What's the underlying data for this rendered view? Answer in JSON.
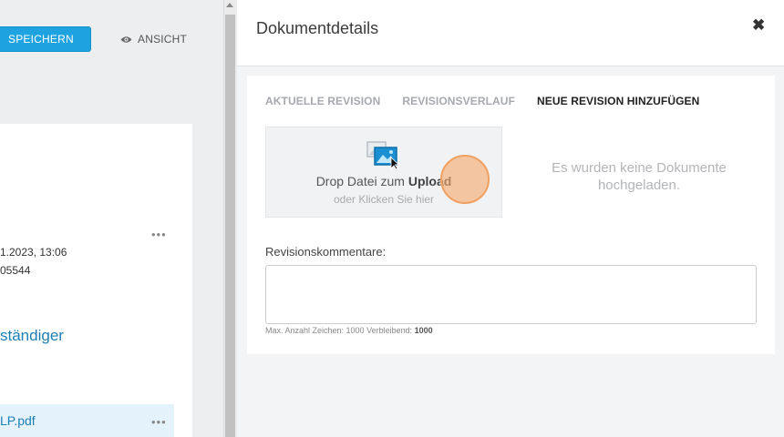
{
  "toolbar": {
    "save_label": "SPEICHERN",
    "view_label": "ANSICHT"
  },
  "background_card": {
    "meta_date": "1.2023, 13:06",
    "meta_id": "05544",
    "section_title": "ständiger",
    "file_name": "LP.pdf",
    "more_dots": "•••"
  },
  "panel": {
    "title": "Dokumentdetails",
    "close_glyph": "✖",
    "tabs": [
      {
        "label": "AKTUELLE REVISION",
        "active": false
      },
      {
        "label": "REVISIONSVERLAUF",
        "active": false
      },
      {
        "label": "NEUE REVISION HINZUFÜGEN",
        "active": true
      }
    ],
    "dropzone": {
      "text_prefix": "Drop Datei zum ",
      "text_bold": "Upload",
      "subtext": "oder Klicken Sie hier",
      "icon": "image-upload-icon"
    },
    "empty_message": "Es wurden keine Dokumente hochgeladen.",
    "comment": {
      "label": "Revisionskommentare:",
      "value": "",
      "counter_prefix": "Max. Anzahl Zeichen: 1000 Verbleibend: ",
      "counter_remaining": "1000"
    }
  },
  "colors": {
    "primary": "#1fa3e0",
    "link": "#1d7fb5",
    "highlight_row": "#e4f3fb",
    "cursor_marker": "#f6aa6e"
  }
}
